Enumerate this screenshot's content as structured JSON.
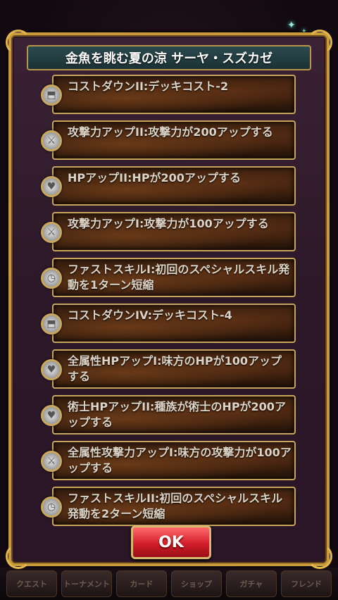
{
  "dialog": {
    "title": "金魚を眺む夏の涼 サーヤ・スズカゼ",
    "ok_label": "OK"
  },
  "skills": [
    {
      "text": "コストダウンII:デッキコスト-2",
      "icon": "cost-icon"
    },
    {
      "text": "攻撃力アップII:攻撃力が200アップする",
      "icon": "sword-icon"
    },
    {
      "text": "HPアップII:HPが200アップする",
      "icon": "heart-icon"
    },
    {
      "text": "攻撃力アップI:攻撃力が100アップする",
      "icon": "sword-icon"
    },
    {
      "text": "ファストスキルI:初回のスペシャルスキル発動を1ターン短縮",
      "icon": "clock-icon"
    },
    {
      "text": "コストダウンIV:デッキコスト-4",
      "icon": "cost-icon"
    },
    {
      "text": "全属性HPアップI:味方のHPが100アップする",
      "icon": "heart-icon"
    },
    {
      "text": "術士HPアップII:種族が術士のHPが200アップする",
      "icon": "heart-icon"
    },
    {
      "text": "全属性攻撃力アップI:味方の攻撃力が100アップする",
      "icon": "sword-icon"
    },
    {
      "text": "ファストスキルII:初回のスペシャルスキル発動を2ターン短縮",
      "icon": "clock-icon"
    }
  ],
  "bottom_nav": [
    {
      "label": "クエスト"
    },
    {
      "label": "トーナメント"
    },
    {
      "label": "カード"
    },
    {
      "label": "ショップ"
    },
    {
      "label": "ガチャ"
    },
    {
      "label": "フレンド"
    }
  ]
}
